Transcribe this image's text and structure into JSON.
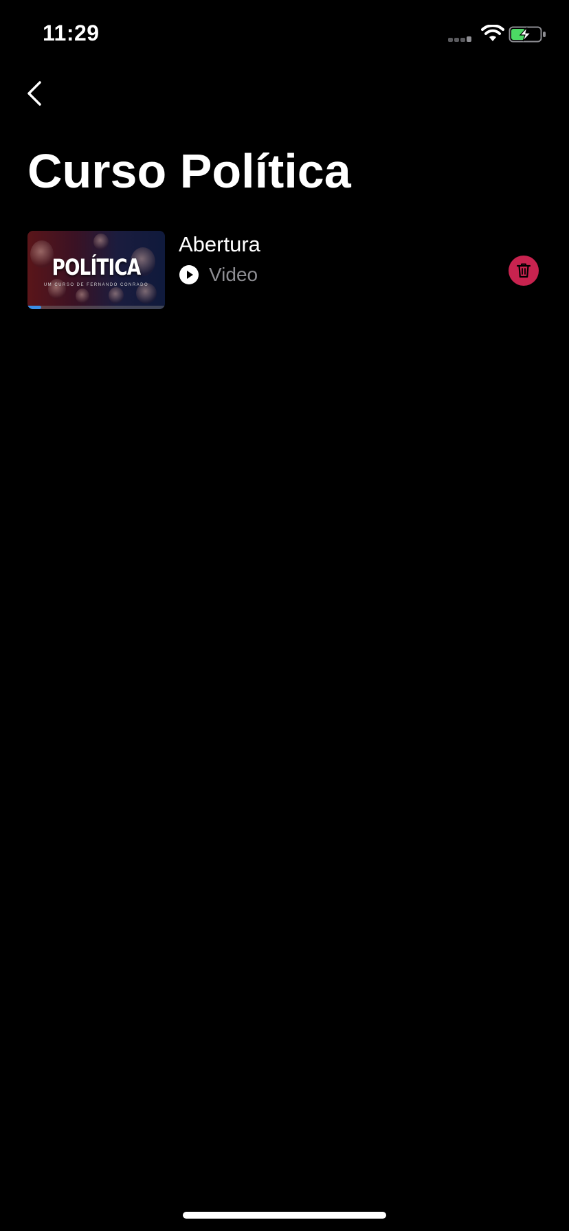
{
  "status_bar": {
    "time": "11:29",
    "icons": [
      "cellular-signal-icon",
      "wifi-icon",
      "battery-charging-icon"
    ],
    "battery_color": "#4cd964"
  },
  "nav": {
    "back_icon": "chevron-left-icon"
  },
  "page": {
    "title": "Curso Política"
  },
  "lessons": [
    {
      "name": "Abertura",
      "type_icon": "play-circle-icon",
      "type_label": "Video",
      "thumbnail": {
        "title": "POLÍTICA",
        "subtitle": "UM CURSO DE FERNANDO CONRADO"
      },
      "progress": 0.1,
      "progress_color": "#3a8ee8",
      "delete_icon": "trash-icon",
      "delete_color": "#c8234f"
    }
  ],
  "colors": {
    "background": "#000000",
    "text_primary": "#ffffff",
    "text_secondary": "#8e8e93"
  }
}
